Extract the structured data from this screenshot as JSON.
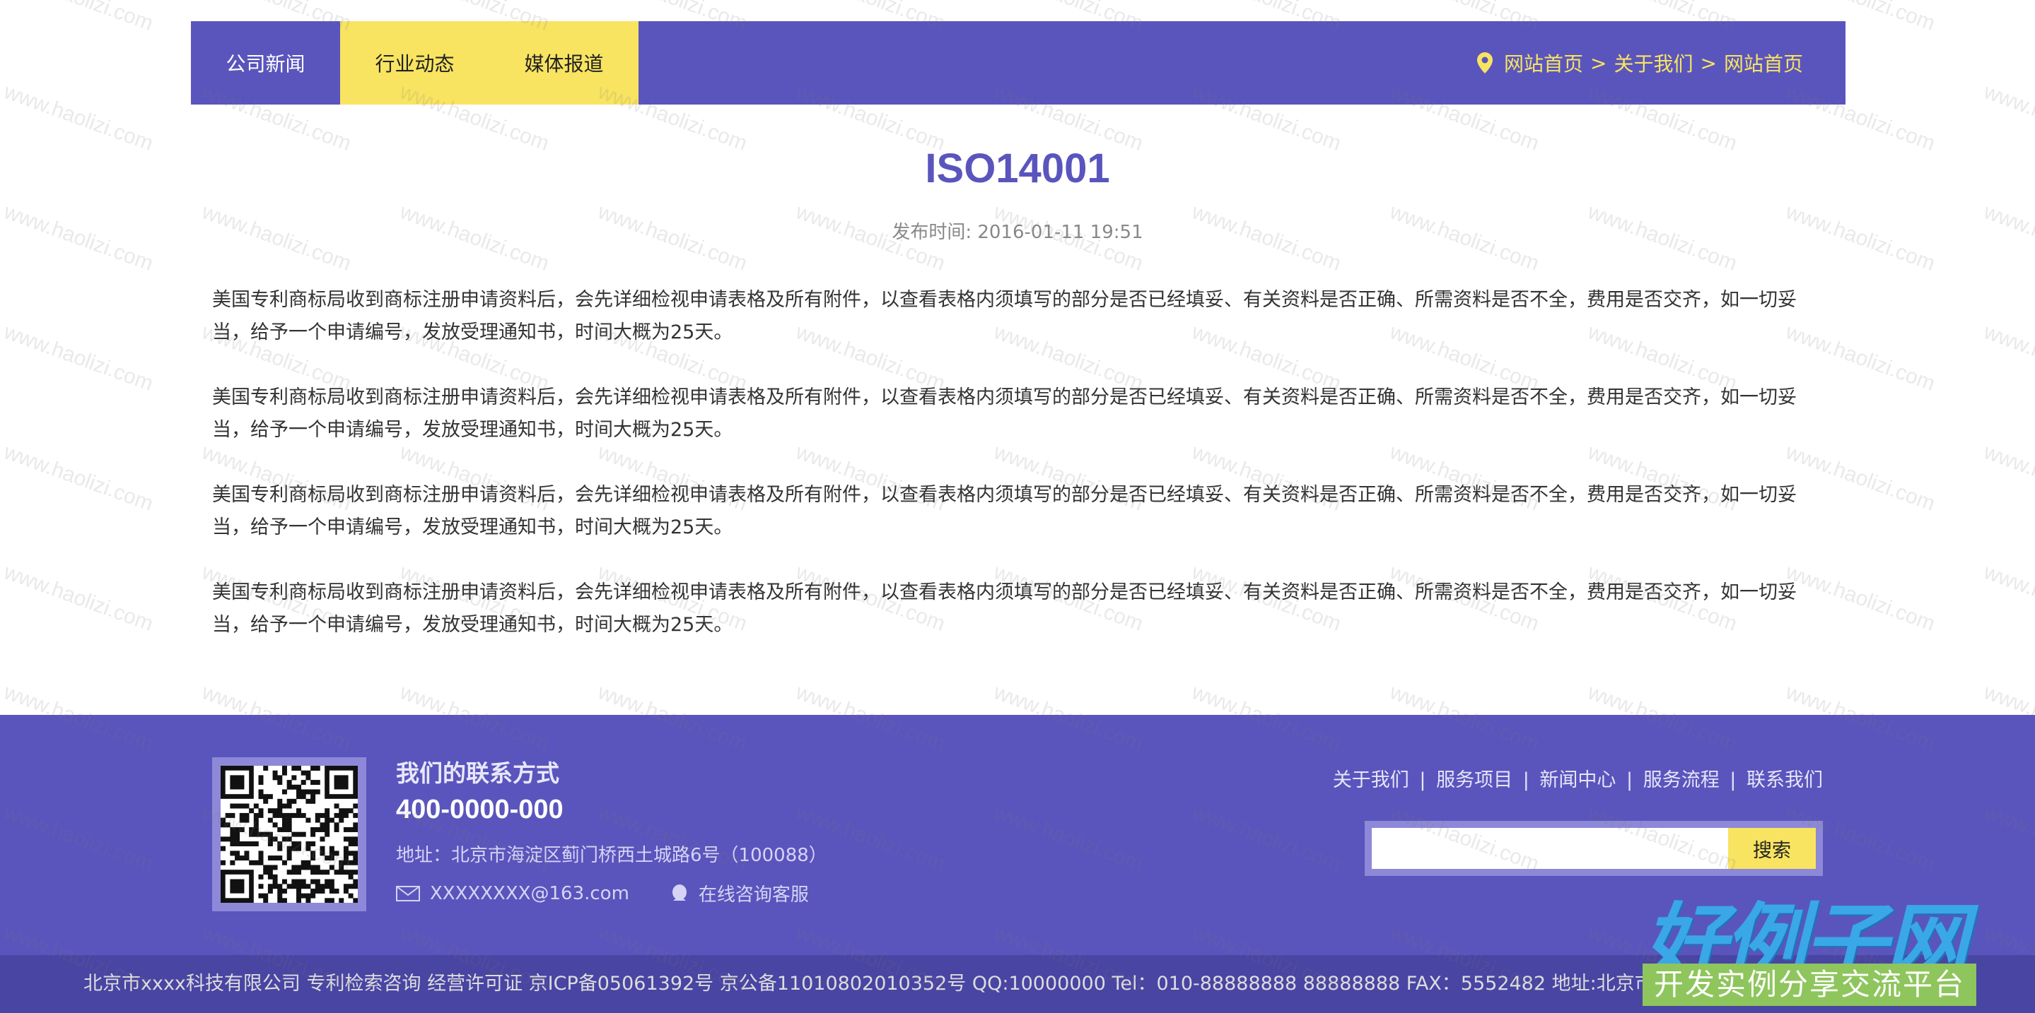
{
  "nav": {
    "items": [
      {
        "label": "公司新闻"
      },
      {
        "label": "行业动态"
      },
      {
        "label": "媒体报道"
      }
    ],
    "breadcrumb": {
      "home": "网站首页",
      "sep": ">",
      "about": "关于我们",
      "current": "网站首页"
    }
  },
  "article": {
    "title": "ISO14001",
    "meta": "发布时间: 2016-01-11 19:51",
    "paragraphs": [
      "美国专利商标局收到商标注册申请资料后，会先详细检视申请表格及所有附件，以查看表格内须填写的部分是否已经填妥、有关资料是否正确、所需资料是否不全，费用是否交齐，如一切妥当，给予一个申请编号，发放受理通知书，时间大概为25天。",
      "美国专利商标局收到商标注册申请资料后，会先详细检视申请表格及所有附件，以查看表格内须填写的部分是否已经填妥、有关资料是否正确、所需资料是否不全，费用是否交齐，如一切妥当，给予一个申请编号，发放受理通知书，时间大概为25天。",
      "美国专利商标局收到商标注册申请资料后，会先详细检视申请表格及所有附件，以查看表格内须填写的部分是否已经填妥、有关资料是否正确、所需资料是否不全，费用是否交齐，如一切妥当，给予一个申请编号，发放受理通知书，时间大概为25天。",
      "美国专利商标局收到商标注册申请资料后，会先详细检视申请表格及所有附件，以查看表格内须填写的部分是否已经填妥、有关资料是否正确、所需资料是否不全，费用是否交齐，如一切妥当，给予一个申请编号，发放受理通知书，时间大概为25天。"
    ]
  },
  "footer": {
    "contact_title": "我们的联系方式",
    "phone": "400-0000-000",
    "address": "地址：北京市海淀区蓟门桥西土城路6号（100088）",
    "email": "XXXXXXXX@163.com",
    "online": "在线咨询客服",
    "links": [
      "关于我们",
      "服务项目",
      "新闻中心",
      "服务流程",
      "联系我们"
    ],
    "link_sep": "|",
    "search": {
      "placeholder": "",
      "button": "搜索"
    },
    "copyright": "北京市xxxx科技有限公司 专利检索咨询 经营许可证 京ICP备05061392号    京公备11010802010352号 QQ:10000000 Tel：010-88888888 88888888 FAX：5552482 地址:北京市海淀区蓟门桥西土城路6号"
  },
  "watermark": "www.haolizi.com",
  "logo": {
    "title": "好例子网",
    "subtitle": "开发实例分享交流平台"
  },
  "colors": {
    "primary": "#5a55bd",
    "accent": "#f8e461",
    "footer_bottom": "#4945a3"
  }
}
